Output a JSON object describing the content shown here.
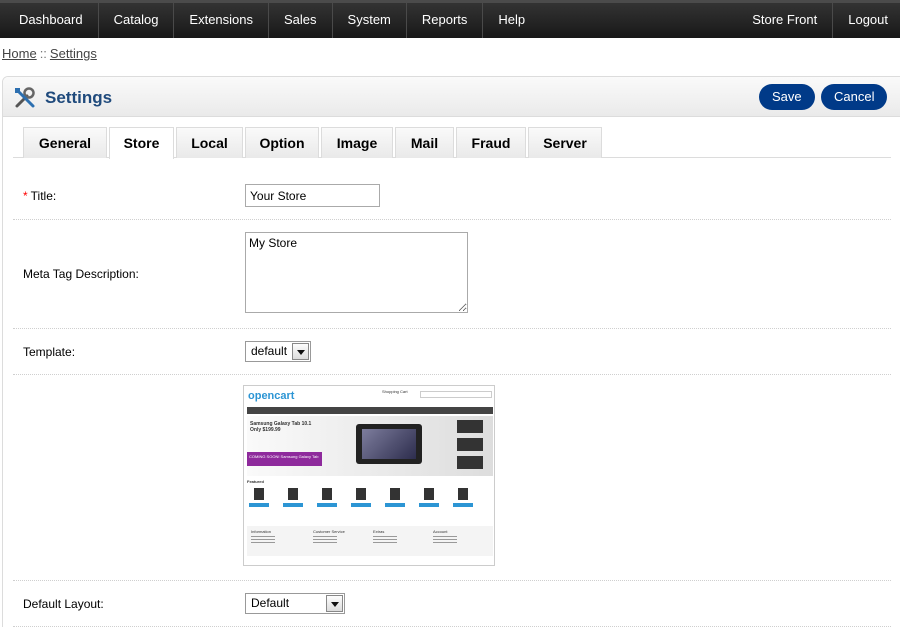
{
  "nav": {
    "left": [
      "Dashboard",
      "Catalog",
      "Extensions",
      "Sales",
      "System",
      "Reports",
      "Help"
    ],
    "right": [
      "Store Front",
      "Logout"
    ]
  },
  "breadcrumb": {
    "home": "Home",
    "separator": "::",
    "current": "Settings"
  },
  "page": {
    "title": "Settings",
    "icon": "settings-tools-icon",
    "save_label": "Save",
    "cancel_label": "Cancel"
  },
  "tabs": [
    "General",
    "Store",
    "Local",
    "Option",
    "Image",
    "Mail",
    "Fraud",
    "Server"
  ],
  "active_tab": "Store",
  "form": {
    "title": {
      "required_mark": "*",
      "label": "Title:",
      "value": "Your Store"
    },
    "meta": {
      "label": "Meta Tag Description:",
      "value": "My Store"
    },
    "template": {
      "label": "Template:",
      "value": "default"
    },
    "default_layout": {
      "label": "Default Layout:",
      "value": "Default"
    }
  },
  "preview": {
    "logo": "opencart",
    "cart": "Shopping Cart",
    "banner_line1": "Samsung Galaxy Tab 10.1",
    "banner_line2": "Only $199.99",
    "promo": "COMING SOON! Samsung Galaxy Tab",
    "featured": "Featured",
    "footer_cols": [
      "Information",
      "Customer Service",
      "Extras",
      "Account"
    ]
  },
  "colors": {
    "accent": "#003a88",
    "title": "#1f4a7c",
    "required": "#ff0000"
  }
}
